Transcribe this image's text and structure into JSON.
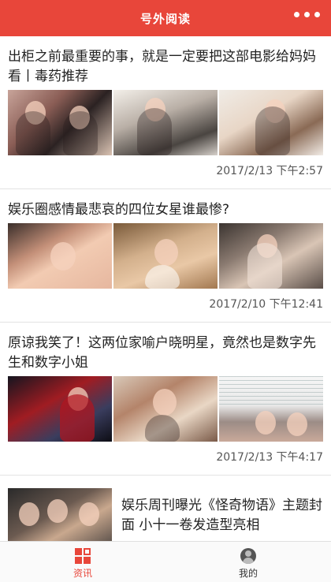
{
  "header": {
    "title": "号外阅读",
    "more_icon": "more-dots-icon"
  },
  "articles": [
    {
      "title": "出柜之前最重要的事，就是一定要把这部电影给妈妈看丨毒药推荐",
      "time": "2017/2/13 下午2:57"
    },
    {
      "title": "娱乐圈感情最悲哀的四位女星谁最惨?",
      "time": "2017/2/10 下午12:41"
    },
    {
      "title": "原谅我笑了！这两位家喻户晓明星，竟然也是数字先生和数字小姐",
      "time": "2017/2/13 下午4:17"
    },
    {
      "title": "娱乐周刊曝光《怪奇物语》主题封面 小十一卷发造型亮相"
    }
  ],
  "tabbar": {
    "tabs": [
      {
        "label": "资讯",
        "icon": "news-grid-icon",
        "active": true
      },
      {
        "label": "我的",
        "icon": "profile-icon",
        "active": false
      }
    ]
  },
  "colors": {
    "brand": "#e8463a",
    "divider": "#e3e3e3",
    "time_text": "#555555"
  }
}
